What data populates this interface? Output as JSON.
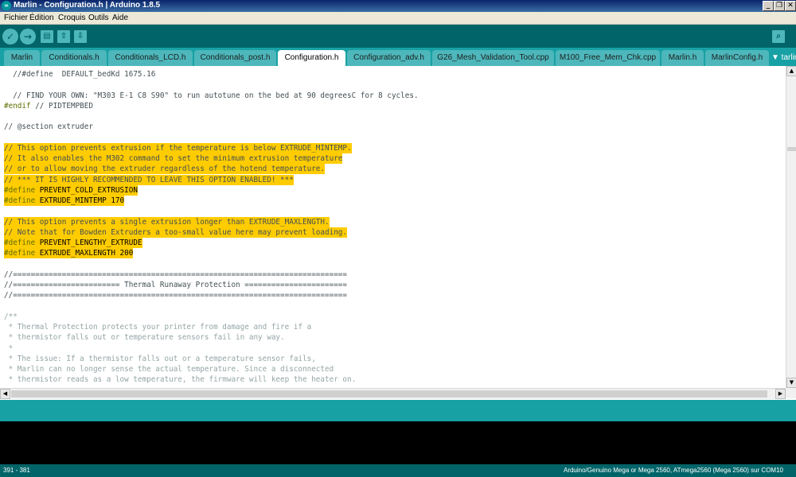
{
  "window": {
    "title": "Marlin - Configuration.h | Arduino 1.8.5",
    "app_icon": "arduino-logo-icon",
    "controls": [
      "_",
      "❐",
      "✕"
    ]
  },
  "menu": [
    "Fichier",
    "Édition",
    "Croquis",
    "Outils",
    "Aide"
  ],
  "toolbar": {
    "verify_icon": "✓",
    "upload_icon": "→",
    "new_icon": "▤",
    "open_icon": "⇧",
    "save_icon": "⇩",
    "serial_icon": "⌕"
  },
  "tabs": [
    {
      "label": "Marlin"
    },
    {
      "label": "Conditionals.h"
    },
    {
      "label": "Conditionals_LCD.h"
    },
    {
      "label": "Conditionals_post.h"
    },
    {
      "label": "Configuration.h"
    },
    {
      "label": "Configuration_adv.h"
    },
    {
      "label": "G26_Mesh_Validation_Tool.cpp"
    },
    {
      "label": "M100_Free_Mem_Chk.cpp"
    },
    {
      "label": "Marlin.h"
    },
    {
      "label": "MarlinConfig.h"
    },
    {
      "label": "▼ tarlin"
    }
  ],
  "code_lines": [
    "  //#define  DEFAULT_bedKd 1675.16",
    "",
    "  // FIND YOUR OWN: \"M303 E-1 C8 S90\" to run autotune on the bed at 90 degreesC for 8 cycles.",
    "#endif // PIDTEMPBED",
    "",
    "// @section extruder",
    "",
    "// This option prevents extrusion if the temperature is below EXTRUDE_MINTEMP.",
    "// It also enables the M302 command to set the minimum extrusion temperature",
    "// or to allow moving the extruder regardless of the hotend temperature.",
    "// *** IT IS HIGHLY RECOMMENDED TO LEAVE THIS OPTION ENABLED! ***",
    "#define PREVENT_COLD_EXTRUSION",
    "#define EXTRUDE_MINTEMP 170",
    "",
    "// This option prevents a single extrusion longer than EXTRUDE_MAXLENGTH.",
    "// Note that for Bowden Extruders a too-small value here may prevent loading.",
    "#define PREVENT_LENGTHY_EXTRUDE",
    "#define EXTRUDE_MAXLENGTH 200",
    "",
    "//===========================================================================",
    "//======================== Thermal Runaway Protection =======================",
    "//===========================================================================",
    "",
    "/**",
    " * Thermal Protection protects your printer from damage and fire if a",
    " * thermistor falls out or temperature sensors fail in any way.",
    " *",
    " * The issue: If a thermistor falls out or a temperature sensor fails,",
    " * Marlin can no longer sense the actual temperature. Since a disconnected",
    " * thermistor reads as a low temperature, the firmware will keep the heater on."
  ],
  "highlighted_lines": [
    7,
    8,
    9,
    10,
    11,
    12,
    14,
    15,
    16,
    17
  ],
  "status": {
    "line_range": "391 - 381",
    "board": "Arduino/Genuino Mega or Mega 2560, ATmega2560 (Mega 2560) sur COM10"
  },
  "colors": {
    "toolbar": "#006468",
    "tab_bar": "#17a1a5",
    "highlight": "#ffcc00",
    "preprocessor": "#5e6d03",
    "comment": "#95a5a6"
  }
}
